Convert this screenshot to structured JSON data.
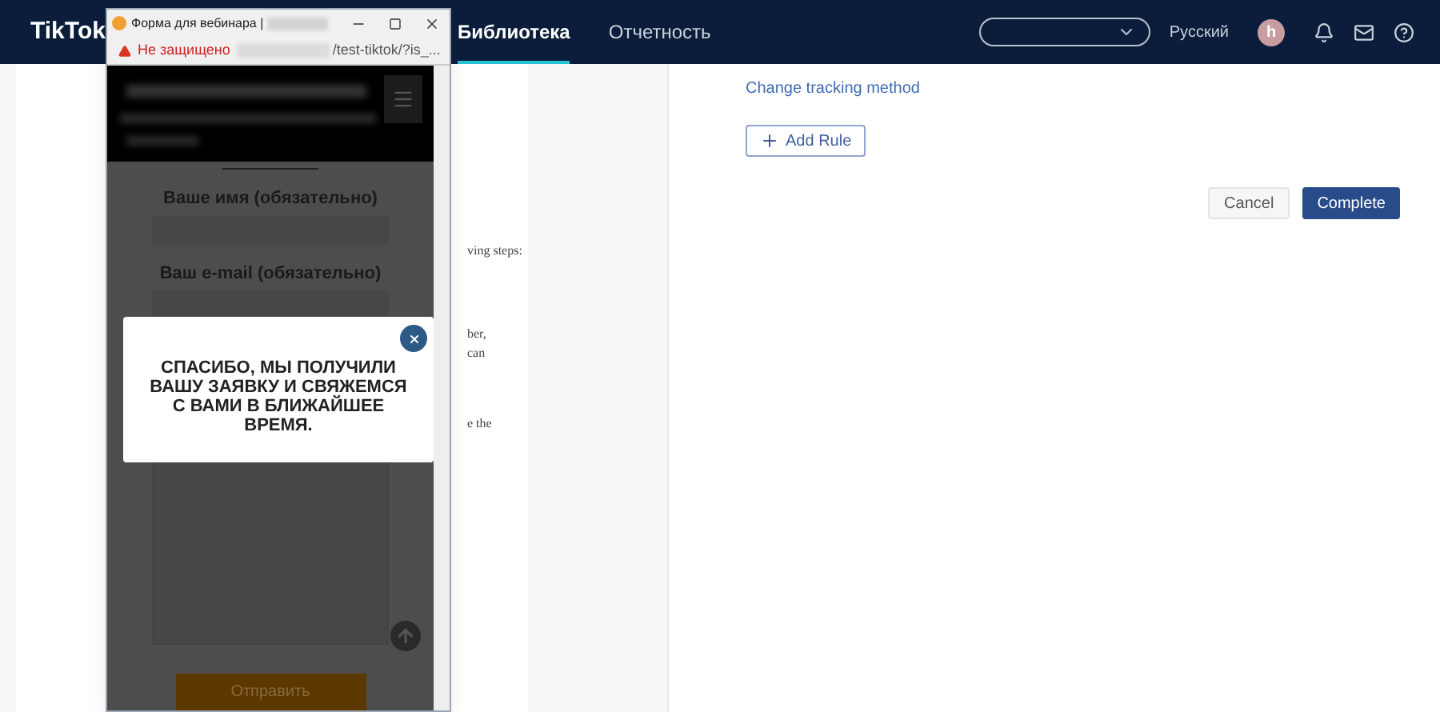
{
  "header": {
    "logo": "TikTok",
    "nav": [
      {
        "label": "Библиотека",
        "selected": true
      },
      {
        "label": "Отчетность",
        "selected": false
      }
    ],
    "language": "Русский",
    "avatar": "h"
  },
  "left_panel": {
    "text_fragments": [
      "ving steps:",
      "ber,",
      "can",
      "e the"
    ]
  },
  "right_panel": {
    "link": "Change tracking method",
    "add_button": "Add Rule",
    "buttons": [
      {
        "label": "Cancel",
        "kind": "secondary"
      },
      {
        "label": "Complete",
        "kind": "primary"
      }
    ]
  },
  "browser_window": {
    "title": "Форма для вебинара |",
    "security": "Не защищено",
    "url": "/test-tiktok/?is_...",
    "form": {
      "fields": [
        {
          "label": "Ваше имя (обязательно)"
        },
        {
          "label": "Ваш e-mail (обязательно)"
        }
      ],
      "submit": "Отправить"
    },
    "modal": {
      "message": "СПАСИБО, МЫ ПОЛУЧИЛИ ВАШУ ЗАЯВКУ И СВЯЖЕМСЯ С ВАМИ В БЛИЖАЙШЕЕ ВРЕМЯ."
    }
  }
}
